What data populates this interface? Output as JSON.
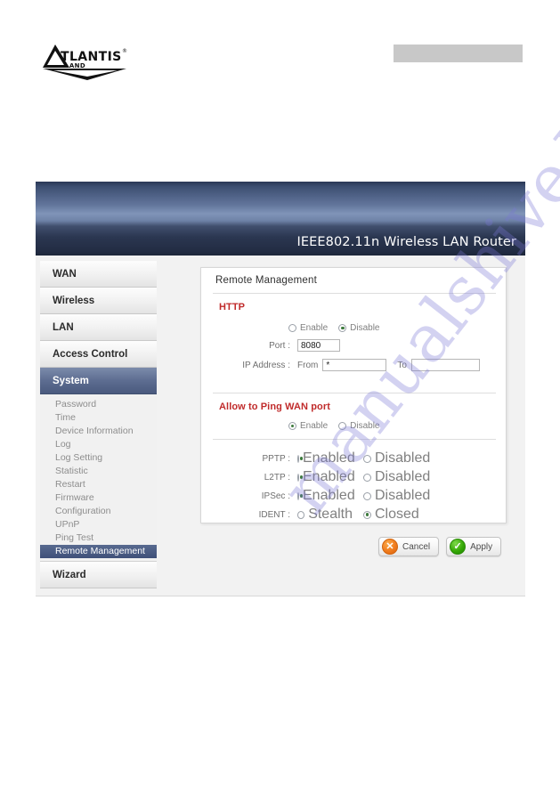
{
  "page": {
    "logo_brand": "ATLANTIS",
    "logo_sub": "LAND",
    "logo_tm": "®"
  },
  "banner": {
    "title": "IEEE802.11n  Wireless LAN Router"
  },
  "watermark": {
    "text": "manualshive.com"
  },
  "sidebar": {
    "top_items": [
      {
        "label": "WAN",
        "active": false
      },
      {
        "label": "Wireless",
        "active": false
      },
      {
        "label": "LAN",
        "active": false
      },
      {
        "label": "Access Control",
        "active": false
      },
      {
        "label": "System",
        "active": true
      }
    ],
    "sub_items": [
      {
        "label": "Password",
        "active": false
      },
      {
        "label": "Time",
        "active": false
      },
      {
        "label": "Device Information",
        "active": false
      },
      {
        "label": "Log",
        "active": false
      },
      {
        "label": "Log Setting",
        "active": false
      },
      {
        "label": "Statistic",
        "active": false
      },
      {
        "label": "Restart",
        "active": false
      },
      {
        "label": "Firmware",
        "active": false
      },
      {
        "label": "Configuration",
        "active": false
      },
      {
        "label": "UPnP",
        "active": false
      },
      {
        "label": "Ping Test",
        "active": false
      },
      {
        "label": "Remote Management",
        "active": true
      }
    ],
    "wizard_item": {
      "label": "Wizard",
      "active": false
    }
  },
  "panel": {
    "card_title": "Remote Management",
    "http": {
      "heading": "HTTP",
      "enable_label": "Enable",
      "disable_label": "Disable",
      "selected": "Disable",
      "port_label": "Port :",
      "port_value": "8080",
      "ip_label": "IP Address :",
      "from_label": "From",
      "from_value": "*",
      "to_label": "To",
      "to_value": ""
    },
    "ping": {
      "heading": "Allow to Ping WAN port",
      "enable_label": "Enable",
      "disable_label": "Disable",
      "selected": "Enable"
    },
    "protocols": [
      {
        "label": "PPTP :",
        "option_a": "Enabled",
        "option_b": "Disabled",
        "selected": "Enabled"
      },
      {
        "label": "L2TP :",
        "option_a": "Enabled",
        "option_b": "Disabled",
        "selected": "Enabled"
      },
      {
        "label": "IPSec :",
        "option_a": "Enabled",
        "option_b": "Disabled",
        "selected": "Enabled"
      },
      {
        "label": "IDENT :",
        "option_a": "Stealth",
        "option_b": "Closed",
        "selected": "Closed"
      }
    ],
    "buttons": {
      "cancel_label": "Cancel",
      "cancel_icon": "x-mark-icon",
      "apply_label": "Apply",
      "apply_icon": "check-mark-icon"
    }
  },
  "colors": {
    "accent_red": "#c02b2b",
    "banner_dark": "#1d2639",
    "nav_active": "#4a5a7e",
    "cancel_orange": "#f07c1e",
    "apply_green": "#36a906"
  }
}
